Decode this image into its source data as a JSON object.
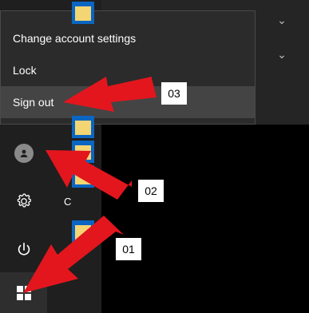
{
  "popup": {
    "items": [
      {
        "label": "Change account settings"
      },
      {
        "label": "Lock"
      },
      {
        "label": "Sign out"
      }
    ]
  },
  "list": {
    "section_letter": "C"
  },
  "annotations": {
    "step_01": "01",
    "step_02": "02",
    "step_03": "03",
    "arrow_color": "#e3161e"
  },
  "theme": {
    "panel_bg": "#252525",
    "accent_blue": "#0a66c2",
    "folder_yellow": "#f4d574"
  },
  "icons": [
    "chevron-down-icon",
    "user-avatar-icon",
    "gear-icon",
    "power-icon",
    "windows-logo-icon",
    "folder-icon"
  ]
}
